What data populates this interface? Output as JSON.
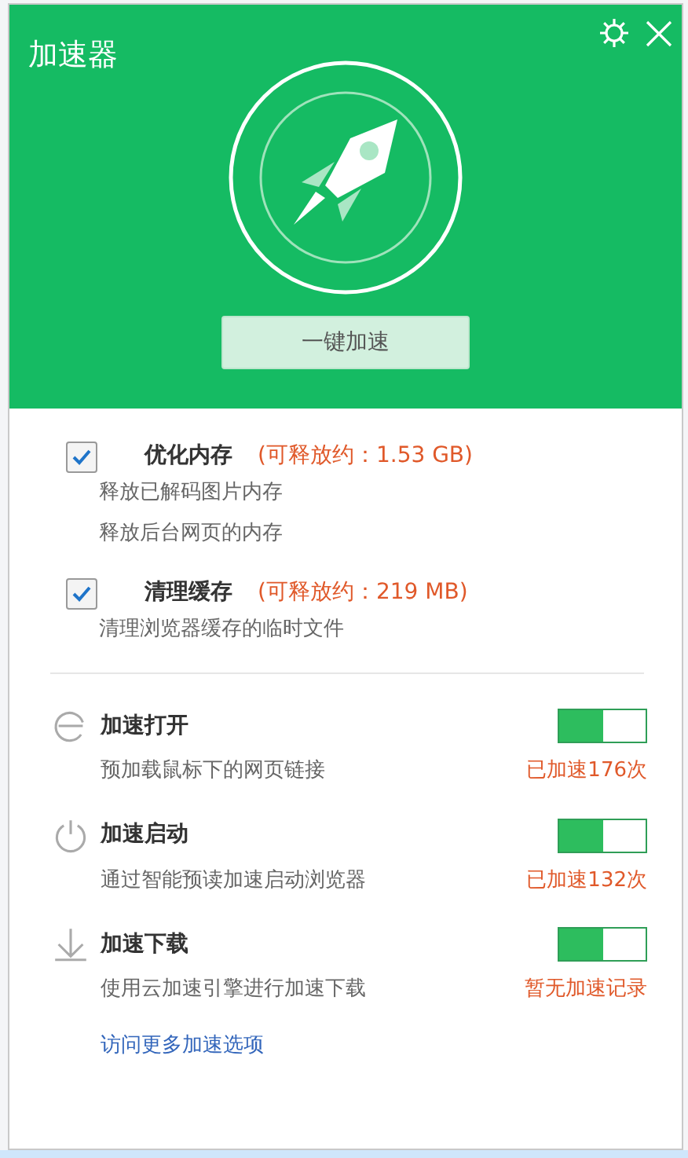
{
  "window": {
    "title": "加速器"
  },
  "boost_button": "一键加速",
  "cleanup_items": [
    {
      "label": "优化内存",
      "checked": true,
      "estimate": "(可释放约：1.53 GB)",
      "details": [
        "释放已解码图片内存",
        "释放后台网页的内存"
      ]
    },
    {
      "label": "清理缓存",
      "checked": true,
      "estimate": "(可释放约：219 MB)",
      "details": [
        "清理浏览器缓存的临时文件"
      ]
    }
  ],
  "features": [
    {
      "kind": "open",
      "label": "加速打开",
      "on": true,
      "description": "预加载鼠标下的网页链接",
      "stat": "已加速176次"
    },
    {
      "kind": "startup",
      "label": "加速启动",
      "on": true,
      "description": "通过智能预读加速启动浏览器",
      "stat": "已加速132次"
    },
    {
      "kind": "download",
      "label": "加速下载",
      "on": true,
      "description": "使用云加速引擎进行加速下载",
      "stat": "暂无加速记录"
    }
  ],
  "more_link": "访问更多加速选项"
}
